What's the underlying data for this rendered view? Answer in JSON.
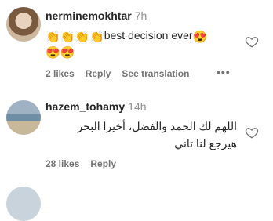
{
  "comments": [
    {
      "username": "nerminemokhtar",
      "time": "7h",
      "text_line1_emojis": "👏👏👏👏",
      "text_line1_text": "best decision ever",
      "text_line1_end_emoji": "😍",
      "text_line2_emojis": "😍😍",
      "likes": "2 likes",
      "reply": "Reply",
      "translation": "See translation",
      "more": "•••"
    },
    {
      "username": "hazem_tohamy",
      "time": "14h",
      "text_line1": "اللهم لك الحمد والفضل، أخيرا البحر",
      "text_line2": "هيرجع لنا تاني",
      "likes": "28 likes",
      "reply": "Reply"
    }
  ],
  "icons": {
    "heart": "heart-outline-icon"
  }
}
